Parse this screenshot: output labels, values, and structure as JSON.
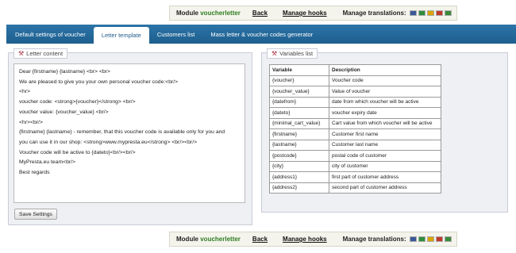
{
  "toolbar": {
    "module_prefix": "Module",
    "module_name": "voucherletter",
    "back": "Back",
    "manage_hooks": "Manage hooks",
    "manage_translations": "Manage translations:",
    "flags": [
      {
        "name": "us-flag-icon",
        "color": "#3b5998"
      },
      {
        "name": "br-flag-icon",
        "color": "#2f8f3a"
      },
      {
        "name": "es-flag-icon",
        "color": "#d9a400"
      },
      {
        "name": "de-flag-icon",
        "color": "#c0392b"
      },
      {
        "name": "it-flag-icon",
        "color": "#3a8a3a"
      }
    ]
  },
  "tabs": [
    {
      "label": "Default settings of voucher",
      "active": false
    },
    {
      "label": "Letter template",
      "active": true
    },
    {
      "label": "Customers list",
      "active": false
    },
    {
      "label": "Mass letter & voucher codes generator",
      "active": false
    }
  ],
  "letter_panel": {
    "title": "Letter content",
    "lines": [
      "Dear {firstname} {lastname} <br> <br>",
      "We are pleased to give you your own personal voucher code:<br/>",
      "<hr>",
      "voucher code: <strong>{voucher}</strong> <br/>",
      "voucher value: {voucher_value} <br/>",
      "<hr><br/>",
      "{firstname} {lastname} - remember, that this voucher code is available only for you and",
      "you can use it in our shop: <strong>www.mypresta.eu</strong> <br/><br/>",
      "Voucher code will be active to {dateto}<br/><br/>",
      "MyPresta.eu team<br/>",
      "Best regards"
    ],
    "save_button": "Save Settings"
  },
  "variables_panel": {
    "title": "Variables list",
    "headers": [
      "Variable",
      "Description"
    ],
    "rows": [
      [
        "{voucher}",
        "Voucher code"
      ],
      [
        "{voucher_value}",
        "Value of voucher"
      ],
      [
        "{datefrom}",
        "date from which voucher will be active"
      ],
      [
        "{dateto}",
        "voucher expiry date"
      ],
      [
        "{minimal_cart_value}",
        "Cart value from which voucher will be active"
      ],
      [
        "{firstname}",
        "Customer first name"
      ],
      [
        "{lastname}",
        "Customer last name"
      ],
      [
        "{postcode}",
        "postal code of customer"
      ],
      [
        "{city}",
        "city of customer"
      ],
      [
        "{address1}",
        "first part of customer address"
      ],
      [
        "{address2}",
        "second part of customer address"
      ]
    ]
  }
}
